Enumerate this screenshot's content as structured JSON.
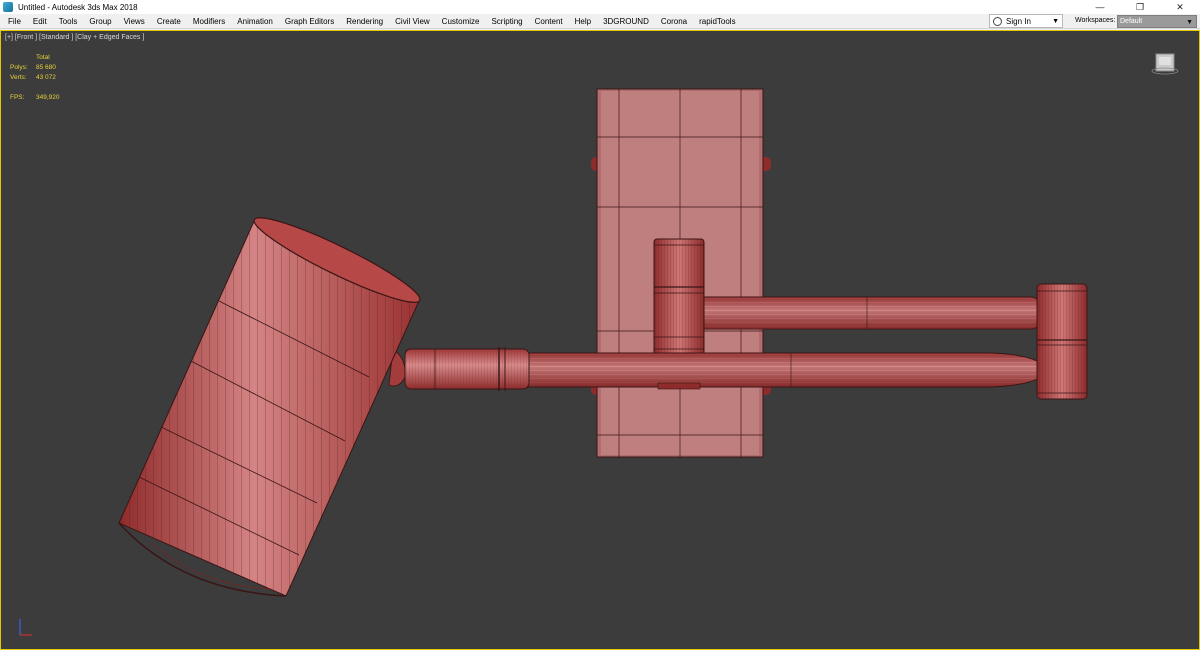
{
  "window": {
    "title": "Untitled - Autodesk 3ds Max 2018",
    "minimize_glyph": "—",
    "maximize_glyph": "❐",
    "close_glyph": "✕"
  },
  "menu": {
    "items": [
      "File",
      "Edit",
      "Tools",
      "Group",
      "Views",
      "Create",
      "Modifiers",
      "Animation",
      "Graph Editors",
      "Rendering",
      "Civil View",
      "Customize",
      "Scripting",
      "Content",
      "Help",
      "3DGROUND",
      "Corona",
      "rapidTools"
    ]
  },
  "signin": {
    "label": "Sign In",
    "icon": "user-icon"
  },
  "workspaces": {
    "label": "Workspaces:",
    "value": "Default"
  },
  "viewport": {
    "label": "[+] [Front ] [Standard ] [Clay + Edged Faces ]",
    "stats": {
      "header": "Total",
      "polys_label": "Polys:",
      "polys_value": "85 680",
      "verts_label": "Verts:",
      "verts_value": "43 072",
      "fps_label": "FPS:",
      "fps_value": "349,920"
    },
    "colors": {
      "background": "#3c3c3c",
      "model": "#b24a4a",
      "model_light": "#d98a8a",
      "wire": "#3a1515",
      "stats_text": "#e7d33a",
      "border": "#e1c900"
    }
  }
}
